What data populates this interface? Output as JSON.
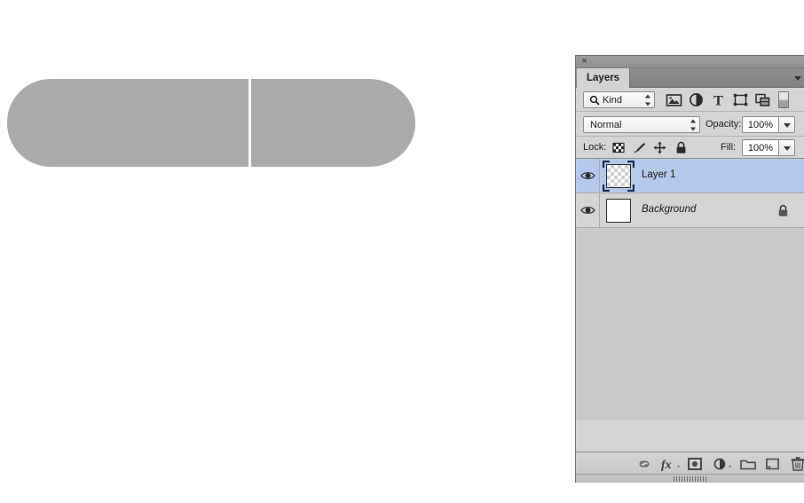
{
  "canvas": {
    "shape_name": "rounded-capsule-shape",
    "shape_fill": "#ababab",
    "background": "#ffffff",
    "divider_note": "vertical light gap between halves"
  },
  "panel": {
    "title": "Layers",
    "close_glyph": "×",
    "menu_glyph": "▾",
    "background": "#d4d4d4",
    "list_background": "#c8c8c8",
    "selected_row_color": "#b4c9ec"
  },
  "filter_row": {
    "kind_label": "Kind",
    "search_icon": "search-icon",
    "type_filters": [
      {
        "name": "pixel-layer-filter-icon",
        "title": "Filter for pixel layers"
      },
      {
        "name": "adjustment-layer-filter-icon",
        "title": "Filter for adjustment layers"
      },
      {
        "name": "type-layer-filter-icon",
        "title": "Filter for type layers"
      },
      {
        "name": "shape-layer-filter-icon",
        "title": "Filter for shape layers"
      },
      {
        "name": "smart-object-filter-icon",
        "title": "Filter for smart objects"
      }
    ],
    "filter_toggle": "filter-enable-toggle"
  },
  "blend_row": {
    "blend_mode": "Normal",
    "opacity_label": "Opacity:",
    "opacity_value": "100%"
  },
  "lock_row": {
    "lock_label": "Lock:",
    "lock_buttons": [
      {
        "name": "lock-transparent-pixels-icon",
        "title": "Lock transparent pixels"
      },
      {
        "name": "lock-image-pixels-icon",
        "title": "Lock image pixels"
      },
      {
        "name": "lock-position-icon",
        "title": "Lock position"
      },
      {
        "name": "lock-all-icon",
        "title": "Lock all"
      }
    ],
    "fill_label": "Fill:",
    "fill_value": "100%"
  },
  "layers": [
    {
      "name": "Layer 1",
      "visible": true,
      "selected": true,
      "italic": false,
      "locked": false,
      "thumbnail": "transparent-checker"
    },
    {
      "name": "Background",
      "visible": true,
      "selected": false,
      "italic": true,
      "locked": true,
      "thumbnail": "white-fill"
    }
  ],
  "footer": {
    "buttons": [
      {
        "name": "link-layers-icon",
        "title": "Link layers"
      },
      {
        "name": "layer-style-fx-icon",
        "title": "Add a layer style"
      },
      {
        "name": "add-layer-mask-icon",
        "title": "Add layer mask"
      },
      {
        "name": "new-adjustment-layer-icon",
        "title": "Create new fill or adjustment layer"
      },
      {
        "name": "new-group-icon",
        "title": "Create a new group"
      },
      {
        "name": "new-layer-icon",
        "title": "Create a new layer"
      },
      {
        "name": "delete-layer-icon",
        "title": "Delete layer"
      }
    ]
  }
}
